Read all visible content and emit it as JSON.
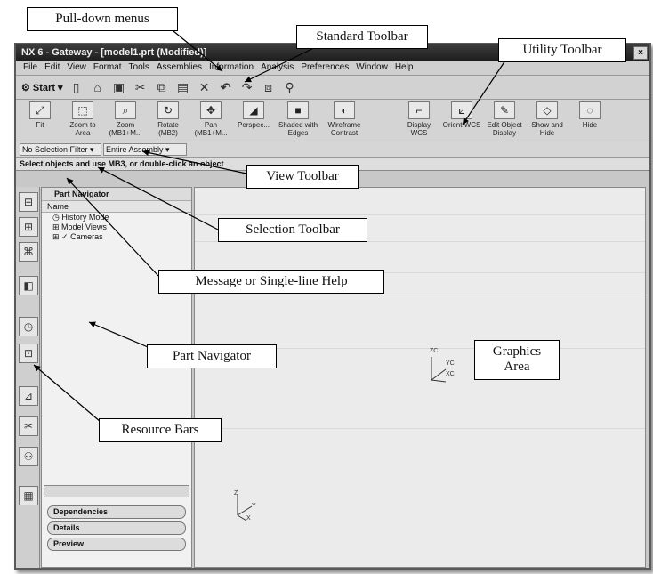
{
  "window": {
    "title": "NX 6 - Gateway - [model1.prt (Modified)]",
    "mdi_controls": "_ |×| ×"
  },
  "menus": [
    "File",
    "Edit",
    "View",
    "Format",
    "Tools",
    "Assemblies",
    "Information",
    "Analysis",
    "Preferences",
    "Window",
    "Help"
  ],
  "standard_toolbar": {
    "start_label": "Start",
    "icons": [
      "new-icon",
      "open-icon",
      "save-icon",
      "cut-icon",
      "copy-icon",
      "paste-icon",
      "delete-icon",
      "undo-icon",
      "redo-icon",
      "command-finder-icon",
      "selection-icon"
    ]
  },
  "view_toolbar": {
    "buttons": [
      "Fit",
      "Zoom to Area",
      "Zoom (MB1+M...",
      "Rotate (MB2)",
      "Pan (MB1+M...",
      "Perspec...",
      "Shaded with Edges",
      "Wireframe Contrast"
    ]
  },
  "utility_toolbar": {
    "buttons": [
      "Display WCS",
      "Orient WCS",
      "Edit Object Display",
      "Show and Hide",
      "Hide"
    ]
  },
  "selection_toolbar": {
    "filter": "No Selection Filter",
    "scope": "Entire Assembly"
  },
  "message_line": "Select objects and use MB3, or double-click an object",
  "part_navigator": {
    "title": "Part Navigator",
    "column": "Name",
    "items": [
      "History Mode",
      "Model Views",
      "Cameras"
    ],
    "sections": [
      "Dependencies",
      "Details",
      "Preview"
    ]
  },
  "triad_labels": {
    "zc": "ZC",
    "yc": "YC",
    "xc": "XC",
    "z": "Z",
    "y": "Y",
    "x": "X"
  },
  "callouts": {
    "pulldown": "Pull-down menus",
    "standard": "Standard Toolbar",
    "utility": "Utility Toolbar",
    "view": "View Toolbar",
    "selection": "Selection Toolbar",
    "message": "Message or Single-line Help",
    "navigator": "Part Navigator",
    "graphics": "Graphics\nArea",
    "resource": "Resource Bars"
  }
}
